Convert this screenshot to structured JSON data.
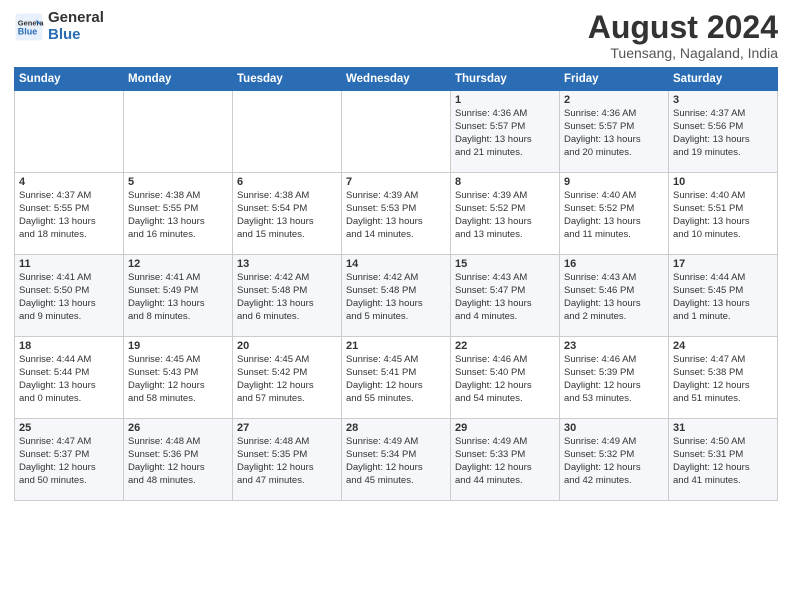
{
  "logo": {
    "line1": "General",
    "line2": "Blue"
  },
  "title": "August 2024",
  "subtitle": "Tuensang, Nagaland, India",
  "weekdays": [
    "Sunday",
    "Monday",
    "Tuesday",
    "Wednesday",
    "Thursday",
    "Friday",
    "Saturday"
  ],
  "weeks": [
    [
      {
        "day": "",
        "text": ""
      },
      {
        "day": "",
        "text": ""
      },
      {
        "day": "",
        "text": ""
      },
      {
        "day": "",
        "text": ""
      },
      {
        "day": "1",
        "text": "Sunrise: 4:36 AM\nSunset: 5:57 PM\nDaylight: 13 hours\nand 21 minutes."
      },
      {
        "day": "2",
        "text": "Sunrise: 4:36 AM\nSunset: 5:57 PM\nDaylight: 13 hours\nand 20 minutes."
      },
      {
        "day": "3",
        "text": "Sunrise: 4:37 AM\nSunset: 5:56 PM\nDaylight: 13 hours\nand 19 minutes."
      }
    ],
    [
      {
        "day": "4",
        "text": "Sunrise: 4:37 AM\nSunset: 5:55 PM\nDaylight: 13 hours\nand 18 minutes."
      },
      {
        "day": "5",
        "text": "Sunrise: 4:38 AM\nSunset: 5:55 PM\nDaylight: 13 hours\nand 16 minutes."
      },
      {
        "day": "6",
        "text": "Sunrise: 4:38 AM\nSunset: 5:54 PM\nDaylight: 13 hours\nand 15 minutes."
      },
      {
        "day": "7",
        "text": "Sunrise: 4:39 AM\nSunset: 5:53 PM\nDaylight: 13 hours\nand 14 minutes."
      },
      {
        "day": "8",
        "text": "Sunrise: 4:39 AM\nSunset: 5:52 PM\nDaylight: 13 hours\nand 13 minutes."
      },
      {
        "day": "9",
        "text": "Sunrise: 4:40 AM\nSunset: 5:52 PM\nDaylight: 13 hours\nand 11 minutes."
      },
      {
        "day": "10",
        "text": "Sunrise: 4:40 AM\nSunset: 5:51 PM\nDaylight: 13 hours\nand 10 minutes."
      }
    ],
    [
      {
        "day": "11",
        "text": "Sunrise: 4:41 AM\nSunset: 5:50 PM\nDaylight: 13 hours\nand 9 minutes."
      },
      {
        "day": "12",
        "text": "Sunrise: 4:41 AM\nSunset: 5:49 PM\nDaylight: 13 hours\nand 8 minutes."
      },
      {
        "day": "13",
        "text": "Sunrise: 4:42 AM\nSunset: 5:48 PM\nDaylight: 13 hours\nand 6 minutes."
      },
      {
        "day": "14",
        "text": "Sunrise: 4:42 AM\nSunset: 5:48 PM\nDaylight: 13 hours\nand 5 minutes."
      },
      {
        "day": "15",
        "text": "Sunrise: 4:43 AM\nSunset: 5:47 PM\nDaylight: 13 hours\nand 4 minutes."
      },
      {
        "day": "16",
        "text": "Sunrise: 4:43 AM\nSunset: 5:46 PM\nDaylight: 13 hours\nand 2 minutes."
      },
      {
        "day": "17",
        "text": "Sunrise: 4:44 AM\nSunset: 5:45 PM\nDaylight: 13 hours\nand 1 minute."
      }
    ],
    [
      {
        "day": "18",
        "text": "Sunrise: 4:44 AM\nSunset: 5:44 PM\nDaylight: 13 hours\nand 0 minutes."
      },
      {
        "day": "19",
        "text": "Sunrise: 4:45 AM\nSunset: 5:43 PM\nDaylight: 12 hours\nand 58 minutes."
      },
      {
        "day": "20",
        "text": "Sunrise: 4:45 AM\nSunset: 5:42 PM\nDaylight: 12 hours\nand 57 minutes."
      },
      {
        "day": "21",
        "text": "Sunrise: 4:45 AM\nSunset: 5:41 PM\nDaylight: 12 hours\nand 55 minutes."
      },
      {
        "day": "22",
        "text": "Sunrise: 4:46 AM\nSunset: 5:40 PM\nDaylight: 12 hours\nand 54 minutes."
      },
      {
        "day": "23",
        "text": "Sunrise: 4:46 AM\nSunset: 5:39 PM\nDaylight: 12 hours\nand 53 minutes."
      },
      {
        "day": "24",
        "text": "Sunrise: 4:47 AM\nSunset: 5:38 PM\nDaylight: 12 hours\nand 51 minutes."
      }
    ],
    [
      {
        "day": "25",
        "text": "Sunrise: 4:47 AM\nSunset: 5:37 PM\nDaylight: 12 hours\nand 50 minutes."
      },
      {
        "day": "26",
        "text": "Sunrise: 4:48 AM\nSunset: 5:36 PM\nDaylight: 12 hours\nand 48 minutes."
      },
      {
        "day": "27",
        "text": "Sunrise: 4:48 AM\nSunset: 5:35 PM\nDaylight: 12 hours\nand 47 minutes."
      },
      {
        "day": "28",
        "text": "Sunrise: 4:49 AM\nSunset: 5:34 PM\nDaylight: 12 hours\nand 45 minutes."
      },
      {
        "day": "29",
        "text": "Sunrise: 4:49 AM\nSunset: 5:33 PM\nDaylight: 12 hours\nand 44 minutes."
      },
      {
        "day": "30",
        "text": "Sunrise: 4:49 AM\nSunset: 5:32 PM\nDaylight: 12 hours\nand 42 minutes."
      },
      {
        "day": "31",
        "text": "Sunrise: 4:50 AM\nSunset: 5:31 PM\nDaylight: 12 hours\nand 41 minutes."
      }
    ]
  ]
}
